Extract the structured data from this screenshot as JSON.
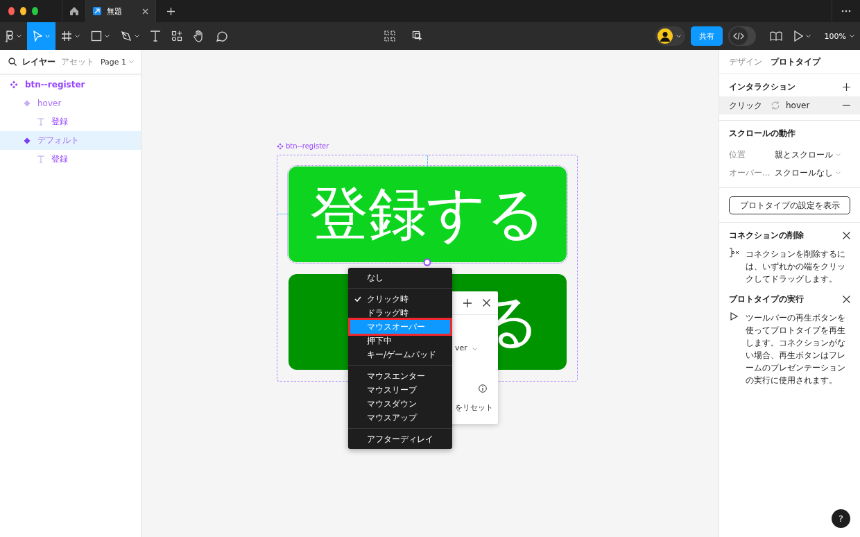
{
  "tabs": [
    {
      "label": "無題",
      "selected": true
    }
  ],
  "toolbar": {
    "share": "共有",
    "zoom": "100%",
    "dev_mode": {
      "on": false
    }
  },
  "left_panel": {
    "tabs": [
      {
        "label": "レイヤー",
        "selected": true
      },
      {
        "label": "アセット",
        "selected": false
      }
    ],
    "page": "Page 1",
    "layers": [
      {
        "name": "btn--register",
        "kind": "component",
        "selected": false,
        "children": [
          {
            "name": "hover",
            "kind": "variant",
            "selected": false,
            "children": [
              {
                "name": "登録",
                "kind": "text",
                "selected": false
              }
            ]
          },
          {
            "name": "デフォルト",
            "kind": "variant",
            "selected": true,
            "children": [
              {
                "name": "登録",
                "kind": "text",
                "selected": false
              }
            ]
          }
        ]
      }
    ]
  },
  "canvas": {
    "frame_label": "btn--register",
    "top_button": "登録する",
    "bottom_button_visible": "る",
    "popup": {
      "partial_value": "ver",
      "partial_reset": "をリセット"
    },
    "menu": {
      "groups": [
        [
          {
            "label": "なし",
            "checked": false,
            "selected": false
          }
        ],
        [
          {
            "label": "クリック時",
            "checked": true,
            "selected": false
          },
          {
            "label": "ドラッグ時",
            "checked": false,
            "selected": false
          },
          {
            "label": "マウスオーバー",
            "checked": false,
            "selected": true
          },
          {
            "label": "押下中",
            "checked": false,
            "selected": false
          },
          {
            "label": "キー/ゲームパッド",
            "checked": false,
            "selected": false
          }
        ],
        [
          {
            "label": "マウスエンター",
            "checked": false,
            "selected": false
          },
          {
            "label": "マウスリーブ",
            "checked": false,
            "selected": false
          },
          {
            "label": "マウスダウン",
            "checked": false,
            "selected": false
          },
          {
            "label": "マウスアップ",
            "checked": false,
            "selected": false
          }
        ],
        [
          {
            "label": "アフターディレイ",
            "checked": false,
            "selected": false
          }
        ]
      ]
    }
  },
  "right_panel": {
    "tabs": [
      {
        "label": "デザイン",
        "selected": false
      },
      {
        "label": "プロトタイプ",
        "selected": true
      }
    ],
    "interactions_title": "インタラクション",
    "interaction": {
      "trigger": "クリック",
      "target": "hover"
    },
    "scroll_title": "スクロールの動作",
    "scroll_rows": [
      {
        "label": "位置",
        "value": "親とスクロール"
      },
      {
        "label": "オーバー...",
        "value": "スクロールなし"
      }
    ],
    "settings_button": "プロトタイプの設定を表示",
    "tips": [
      {
        "title": "コネクションの削除",
        "kind": "connection",
        "text": "コネクションを削除するには、いずれかの端をクリックしてドラッグします。"
      },
      {
        "title": "プロトタイプの実行",
        "kind": "play",
        "text": "ツールバーの再生ボタンを使ってプロトタイプを再生します。コネクションがない場合、再生ボタンはフレームのプレゼンテーションの実行に使用されます。"
      }
    ]
  },
  "help": "?"
}
